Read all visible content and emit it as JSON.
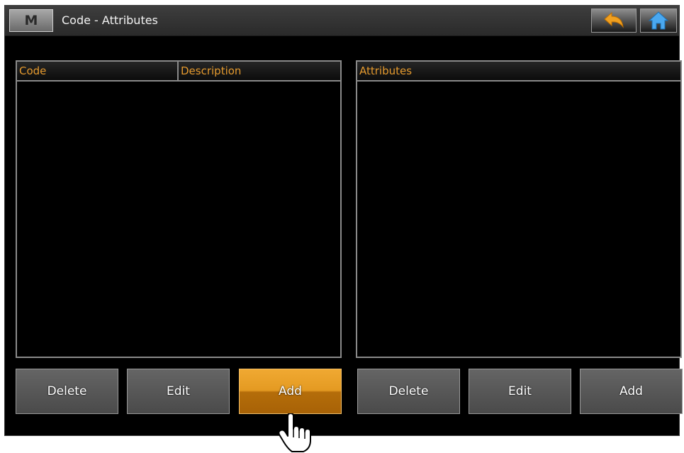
{
  "window": {
    "menu_button_label": "M",
    "title": "Code - Attributes"
  },
  "nav": {
    "back_icon": "back-arrow-icon",
    "home_icon": "home-icon"
  },
  "left_panel": {
    "columns": [
      "Code",
      "Description"
    ],
    "rows": [],
    "buttons": {
      "delete": "Delete",
      "edit": "Edit",
      "add": "Add"
    }
  },
  "right_panel": {
    "columns": [
      "Attributes"
    ],
    "rows": [],
    "buttons": {
      "delete": "Delete",
      "edit": "Edit",
      "add": "Add"
    }
  },
  "colors": {
    "accent": "#e59a2e",
    "background": "#000000",
    "active_button": "#e49a22"
  },
  "active_button": "left_panel.add"
}
